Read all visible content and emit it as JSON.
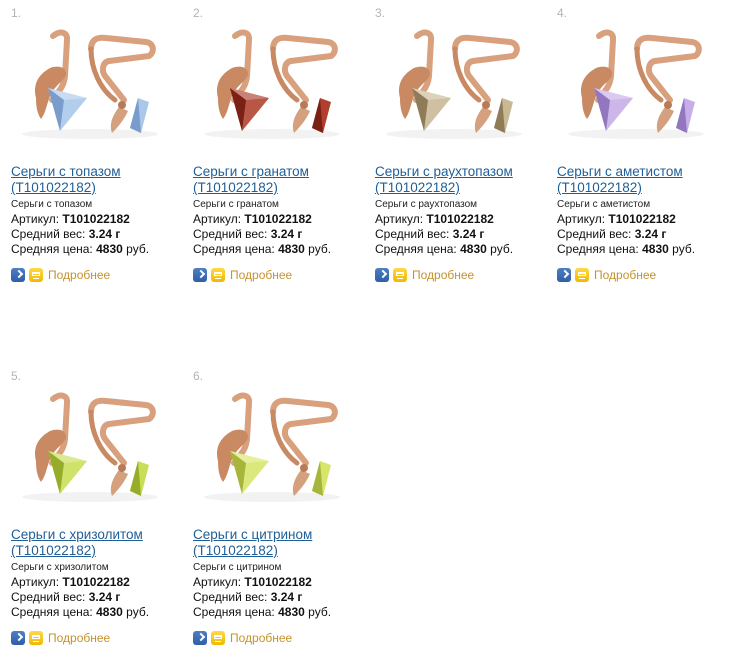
{
  "products": [
    {
      "index": "1.",
      "title_line1": "Серьги с топазом",
      "title_line2": "(T101022182)",
      "subtitle": "Серьги с топазом",
      "article_label": "Артикул:",
      "article": "T101022182",
      "weight_label": "Средний вес:",
      "weight": "3.24 г",
      "price_label": "Средняя цена:",
      "price": "4830",
      "currency": "руб.",
      "more": "Подробнее",
      "gem_color": "#a9c8ea",
      "gem_dark": "#7a9ccc"
    },
    {
      "index": "2.",
      "title_line1": "Серьги с гранатом",
      "title_line2": "(T101022182)",
      "subtitle": "Серьги с гранатом",
      "article_label": "Артикул:",
      "article": "T101022182",
      "weight_label": "Средний вес:",
      "weight": "3.24 г",
      "price_label": "Средняя цена:",
      "price": "4830",
      "currency": "руб.",
      "more": "Подробнее",
      "gem_color": "#b0402d",
      "gem_dark": "#7b2015"
    },
    {
      "index": "3.",
      "title_line1": "Серьги с раухтопазом",
      "title_line2": "(T101022182)",
      "subtitle": "Серьги с раухтопазом",
      "article_label": "Артикул:",
      "article": "T101022182",
      "weight_label": "Средний вес:",
      "weight": "3.24 г",
      "price_label": "Средняя цена:",
      "price": "4830",
      "currency": "руб.",
      "more": "Подробнее",
      "gem_color": "#c9b894",
      "gem_dark": "#8f7b58"
    },
    {
      "index": "4.",
      "title_line1": "Серьги с аметистом",
      "title_line2": "(T101022182)",
      "subtitle": "Серьги с аметистом",
      "article_label": "Артикул:",
      "article": "T101022182",
      "weight_label": "Средний вес:",
      "weight": "3.24 г",
      "price_label": "Средняя цена:",
      "price": "4830",
      "currency": "руб.",
      "more": "Подробнее",
      "gem_color": "#c7aee7",
      "gem_dark": "#9276be"
    },
    {
      "index": "5.",
      "title_line1": "Серьги с хризолитом",
      "title_line2": "(T101022182)",
      "subtitle": "Серьги с хризолитом",
      "article_label": "Артикул:",
      "article": "T101022182",
      "weight_label": "Средний вес:",
      "weight": "3.24 г",
      "price_label": "Средняя цена:",
      "price": "4830",
      "currency": "руб.",
      "more": "Подробнее",
      "gem_color": "#c9de56",
      "gem_dark": "#95ad2b"
    },
    {
      "index": "6.",
      "title_line1": "Серьги с цитрином",
      "title_line2": "(T101022182)",
      "subtitle": "Серьги с цитрином",
      "article_label": "Артикул:",
      "article": "T101022182",
      "weight_label": "Средний вес:",
      "weight": "3.24 г",
      "price_label": "Средняя цена:",
      "price": "4830",
      "currency": "руб.",
      "more": "Подробнее",
      "gem_color": "#d7e66a",
      "gem_dark": "#a7b53d"
    }
  ],
  "colors": {
    "gold": "#d8a07c",
    "gold_dark": "#b97b57",
    "link": "#1f5e96",
    "more": "#c6922a",
    "index": "#b3b3b3"
  },
  "icons": {
    "details": "arrow-right-icon",
    "cart": "cart-icon"
  }
}
